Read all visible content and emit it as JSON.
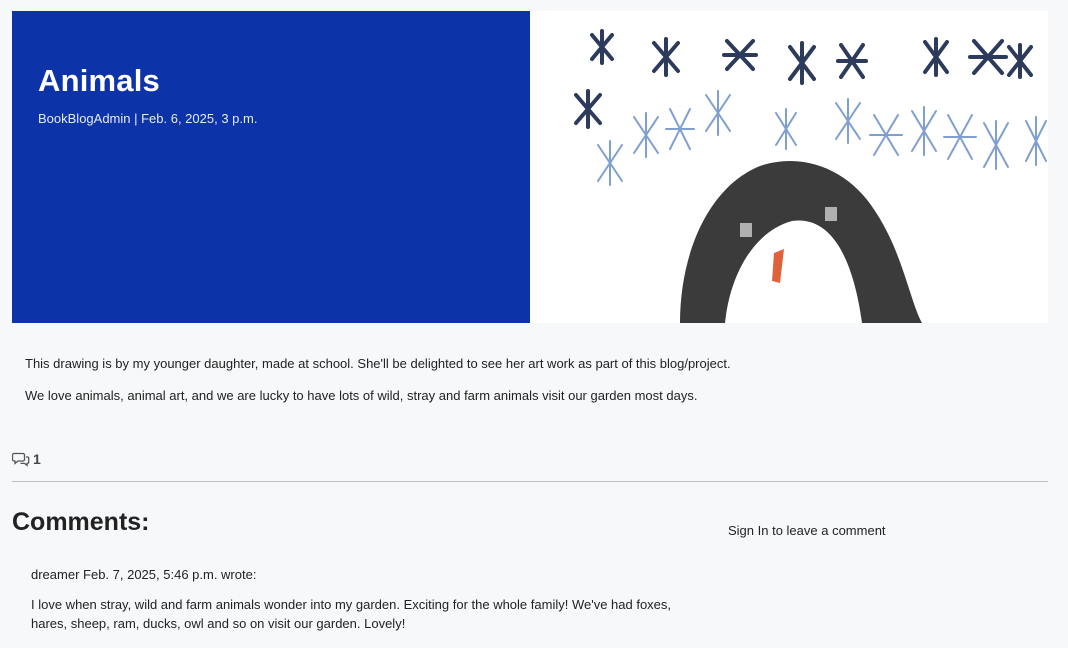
{
  "post": {
    "title": "Animals",
    "meta": "BookBlogAdmin | Feb. 6, 2025, 3 p.m.",
    "paragraphs": [
      "This drawing is by my younger daughter, made at school. She'll be delighted to see her art work as part of this blog/project.",
      "We love animals, animal art, and we are lucky to have lots of wild, stray and farm animals visit our garden most days."
    ],
    "comment_count": "1",
    "hero_color": "#0d33a8"
  },
  "comments": {
    "heading": "Comments:",
    "signin_label": "Sign In to leave a comment",
    "items": [
      {
        "header": "dreamer Feb. 7, 2025, 5:46 p.m. wrote:",
        "body": "I love when stray, wild and farm animals wonder into my garden. Exciting for the whole family! We've had foxes, hares, sheep, ram, ducks, owl and so on visit our garden. Lovely!"
      }
    ]
  },
  "icons": {
    "comment_icon": "comments-icon"
  }
}
